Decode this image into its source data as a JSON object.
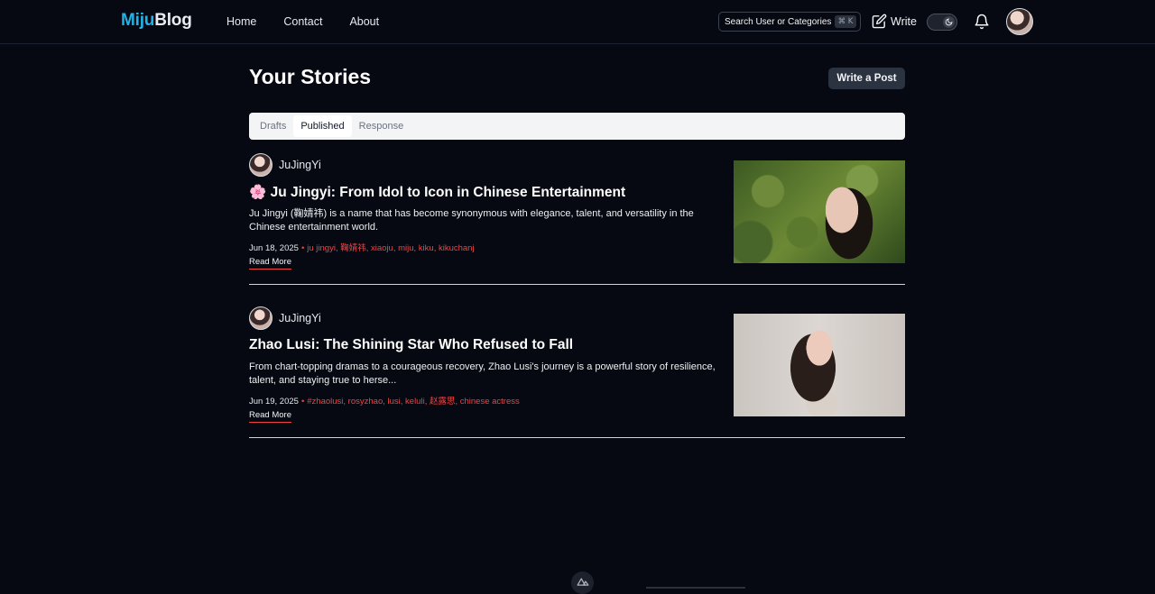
{
  "header": {
    "logo_part1": "Miju",
    "logo_part2": "Blog",
    "nav": [
      "Home",
      "Contact",
      "About"
    ],
    "search_placeholder": "Search User or Categories...",
    "search_shortcut": "⌘ K",
    "write_label": "Write"
  },
  "main": {
    "title": "Your Stories",
    "write_post_label": "Write a Post",
    "tabs": [
      "Drafts",
      "Published",
      "Response"
    ],
    "active_tab": "Published"
  },
  "posts": [
    {
      "author": "JuJingYi",
      "emoji": "🌸",
      "title": "Ju Jingyi: From Idol to Icon in Chinese Entertainment",
      "excerpt": "Ju Jingyi (鞠婧祎) is a name that has become synonymous with elegance, talent, and versatility in the Chinese entertainment world.",
      "date": "Jun 18, 2025",
      "tags": "ju jingyi, 鞠婧祎, xiaoju, miju, kiku, kikuchanj",
      "read_more": "Read More"
    },
    {
      "author": "JuJingYi",
      "emoji": "",
      "title": "Zhao Lusi: The Shining Star Who Refused to Fall",
      "excerpt": "From chart-topping dramas to a courageous recovery, Zhao Lusi's journey is a powerful story of resilience, talent, and staying true to herse...",
      "date": "Jun 19, 2025",
      "tags": "#zhaolusi, rosyzhao, lusi, keluli, 赵露思, chinese actress",
      "read_more": "Read More"
    }
  ],
  "colors": {
    "background": "#060912",
    "brand": "#22b3e6",
    "tag": "#ef4444"
  }
}
